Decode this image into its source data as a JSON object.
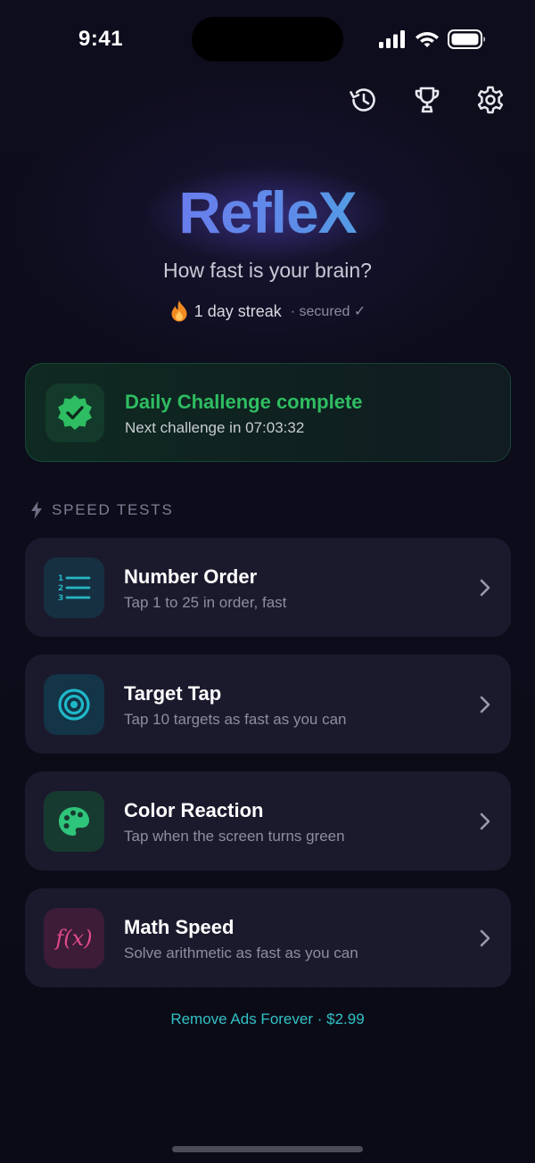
{
  "status_bar": {
    "time": "9:41"
  },
  "toolbar": {
    "icons": [
      "history-icon",
      "trophy-icon",
      "gear-icon"
    ]
  },
  "hero": {
    "app_name": "RefleX",
    "tagline": "How fast is your brain?",
    "streak": {
      "icon": "flame-icon",
      "label": "1 day streak",
      "status": "· secured ✓"
    }
  },
  "daily_challenge": {
    "icon": "verified-badge-icon",
    "title": "Daily Challenge complete",
    "subtitle": "Next challenge in 07:03:32"
  },
  "section": {
    "icon": "bolt-icon",
    "label": "SPEED TESTS"
  },
  "tests": [
    {
      "title": "Number Order",
      "subtitle": "Tap 1 to 25 in order, fast",
      "icon": "numbered-list-icon",
      "accent": "#26b5c2",
      "icon_bg": "#163042"
    },
    {
      "title": "Target Tap",
      "subtitle": "Tap 10 targets as fast as you can",
      "icon": "target-icon",
      "accent": "#1fb8c8",
      "icon_bg": "#143447"
    },
    {
      "title": "Color Reaction",
      "subtitle": "Tap when the screen turns green",
      "icon": "palette-icon",
      "accent": "#2ec47a",
      "icon_bg": "#173a30"
    },
    {
      "title": "Math Speed",
      "subtitle": "Solve arithmetic as fast as you can",
      "icon": "function-icon",
      "icon_text": "f(x)",
      "accent": "#e04a8c",
      "icon_bg": "#3c1c36"
    }
  ],
  "footer": {
    "remove_ads": "Remove Ads Forever · $2.99"
  },
  "colors": {
    "success": "#2ebd62",
    "link": "#31c1c4",
    "card_bg": "#1b1a2d",
    "background": "#0d0d1c"
  }
}
